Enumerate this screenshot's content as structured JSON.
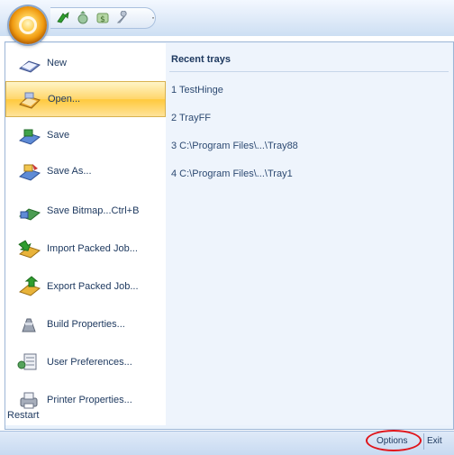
{
  "quick_access": {
    "icons": [
      "green-arrow-icon",
      "gear-arrow-icon",
      "dollar-icon",
      "wrench-icon"
    ],
    "dropdown_label": "·"
  },
  "menu": {
    "items": [
      {
        "label": "New",
        "icon": "new-document-icon"
      },
      {
        "label": "Open...",
        "icon": "open-folder-icon"
      },
      {
        "label": "Save",
        "icon": "save-icon"
      },
      {
        "label": "Save As...",
        "icon": "save-as-icon"
      },
      {
        "label": "Save Bitmap...Ctrl+B",
        "icon": "save-bitmap-icon"
      },
      {
        "label": "Import Packed Job...",
        "icon": "import-packed-job-icon"
      },
      {
        "label": "Export Packed Job...",
        "icon": "export-packed-job-icon"
      },
      {
        "label": "Build Properties...",
        "icon": "build-properties-icon"
      },
      {
        "label": "User Preferences...",
        "icon": "user-preferences-icon"
      },
      {
        "label": "Printer Properties...",
        "icon": "printer-properties-icon"
      }
    ],
    "restart_label": "Restart"
  },
  "recent": {
    "title": "Recent trays",
    "items": [
      "1 TestHinge",
      "2 TrayFF",
      "3 C:\\Program Files\\...\\Tray88",
      "4 C:\\Program Files\\...\\Tray1"
    ]
  },
  "bottom": {
    "options_label": "Options",
    "exit_label": "Exit"
  }
}
